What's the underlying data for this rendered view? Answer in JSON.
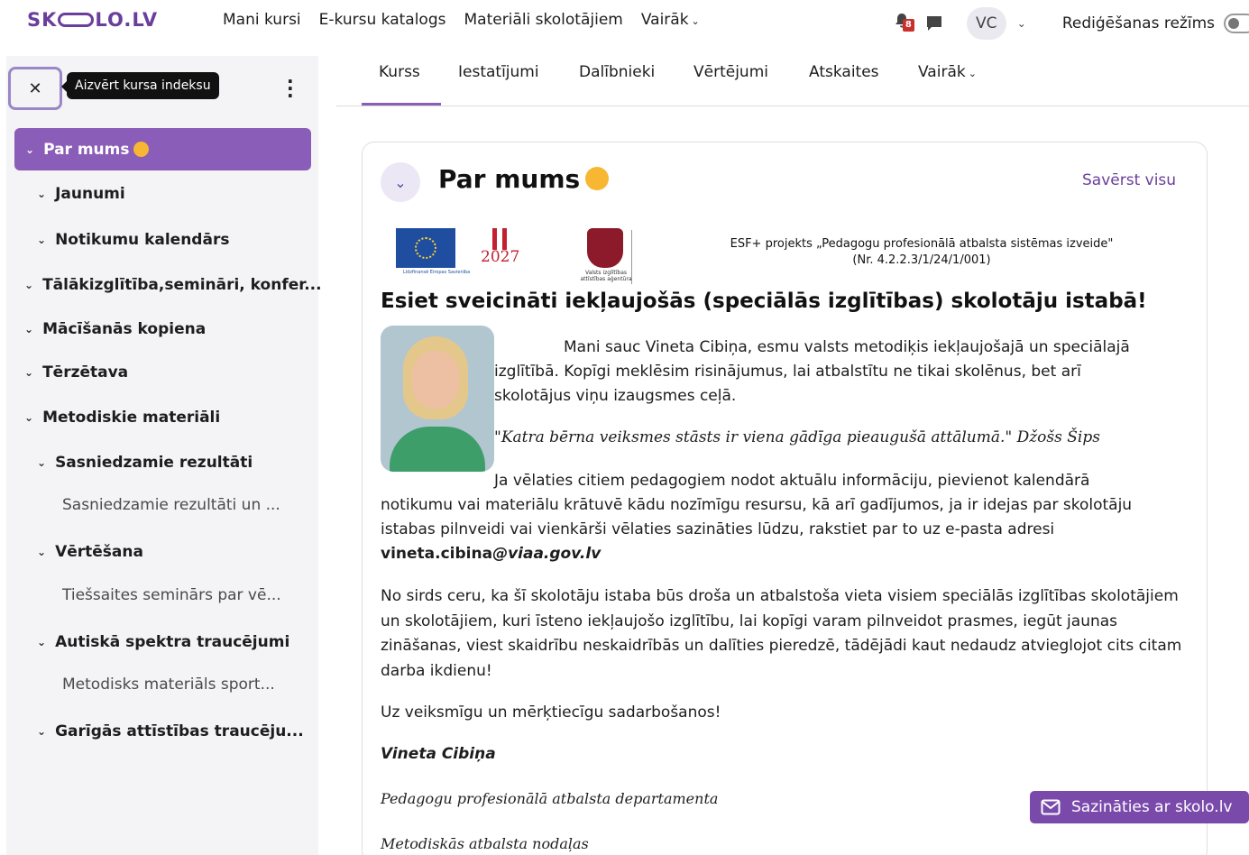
{
  "brand": {
    "logo": "SKOLO.LV",
    "logo_left": "SK",
    "logo_right": "LO.LV"
  },
  "nav": {
    "links": [
      "Mani kursi",
      "E-kursu katalogs",
      "Materiāli skolotājiem",
      "Vairāk"
    ],
    "notification_count": "8",
    "user_initials": "VC",
    "edit_mode_label": "Rediģēšanas režīms"
  },
  "drawer": {
    "close_tooltip": "Aizvērt kursa indeksu",
    "items": [
      {
        "label": "Par mums",
        "level": 0,
        "active": true,
        "type": "section"
      },
      {
        "label": "Jaunumi",
        "level": 1,
        "type": "section"
      },
      {
        "label": "Notikumu kalendārs",
        "level": 1,
        "type": "section"
      },
      {
        "label": "Tālākizglītība,semināri, konfer...",
        "level": 0,
        "type": "section"
      },
      {
        "label": "Mācīšanās kopiena",
        "level": 0,
        "type": "section"
      },
      {
        "label": "Tērzētava",
        "level": 0,
        "type": "section"
      },
      {
        "label": "Metodiskie materiāli",
        "level": 0,
        "type": "section"
      },
      {
        "label": "Sasniedzamie rezultāti",
        "level": 1,
        "type": "section"
      },
      {
        "label": "Sasniedzamie rezultāti un ...",
        "level": 2,
        "type": "activity"
      },
      {
        "label": "Vērtēšana",
        "level": 1,
        "type": "section"
      },
      {
        "label": "Tiešsaites seminārs par vē...",
        "level": 2,
        "type": "activity"
      },
      {
        "label": "Autiskā spektra traucējumi",
        "level": 1,
        "type": "section"
      },
      {
        "label": "Metodisks materiāls sport...",
        "level": 2,
        "type": "activity"
      },
      {
        "label": "Garīgās attīstības traucēju...",
        "level": 1,
        "type": "section"
      }
    ]
  },
  "tabs": [
    "Kurss",
    "Iestatījumi",
    "Dalībnieki",
    "Vērtējumi",
    "Atskaites",
    "Vairāk"
  ],
  "section": {
    "title": "Par mums",
    "collapse_all": "Savērst visu",
    "logo_captions": {
      "eu": "Līdzfinansē Eiropas Savienība",
      "year": "2027",
      "agency": "Valsts izglītības attīstības aģentūra"
    },
    "esf_line1": "ESF+ projekts „Pedagogu profesionālā atbalsta sistēmas izveide\"",
    "esf_line2": "(Nr. 4.2.2.3/1/24/1/001)",
    "heading": "Esiet sveicināti iekļaujošās (speciālās izglītības) skolotāju istabā!",
    "intro_1": "Mani sauc Vineta Cibiņa, esmu valsts metodiķis iekļaujošajā un speciālajā",
    "intro_2": "izglītībā.    Kopīgi meklēsim risinājumus, lai atbalstītu ne tikai skolēnus, bet arī",
    "intro_3": "skolotājus viņu izaugsmes  ceļā.",
    "quote": "\"Katra bērna veiksmes stāsts ir viena gādīga pieaugušā attālumā.\" Džošs Šips",
    "para_contact_1": "Ja vēlaties citiem pedagogiem nodot aktuālu informāciju, pievienot kalendārā",
    "para_contact_2": "notikumu vai materiālu krātuvē kādu nozīmīgu resursu, kā arī gadījumos, ja ir idejas par skolotāju",
    "para_contact_3": "istabas pilnveidi vai vienkārši vēlaties sazināties lūdzu, rakstiet par to uz e-pasta adresi",
    "email_user": "vineta.cibina",
    "email_domain": "@viaa.gov.lv",
    "para_hope": "No sirds ceru, ka šī skolotāju istaba būs droša un atbalstoša vieta visiem speciālās izglītības skolotājiem un skolotājiem, kuri īsteno iekļaujošo izglītību, lai kopīgi varam pilnveidot prasmes, iegūt jaunas zināšanas, viest skaidrību neskaidrībās un dalīties pieredzē, tādējādi kaut nedaudz atvieglojot cits citam darba ikdienu!",
    "para_cooperation": "Uz veiksmīgu un mērķtiecīgu sadarbošanos!",
    "signature": "Vineta Cibiņa",
    "dept": "Pedagogu profesionālā atbalsta departamenta",
    "unit": "Metodiskās atbalsta nodaļas"
  },
  "contact_button": "Sazināties ar skolo.lv",
  "colors": {
    "accent": "#8a5db8",
    "brand": "#6a3e9b",
    "badge": "#c9302c"
  }
}
